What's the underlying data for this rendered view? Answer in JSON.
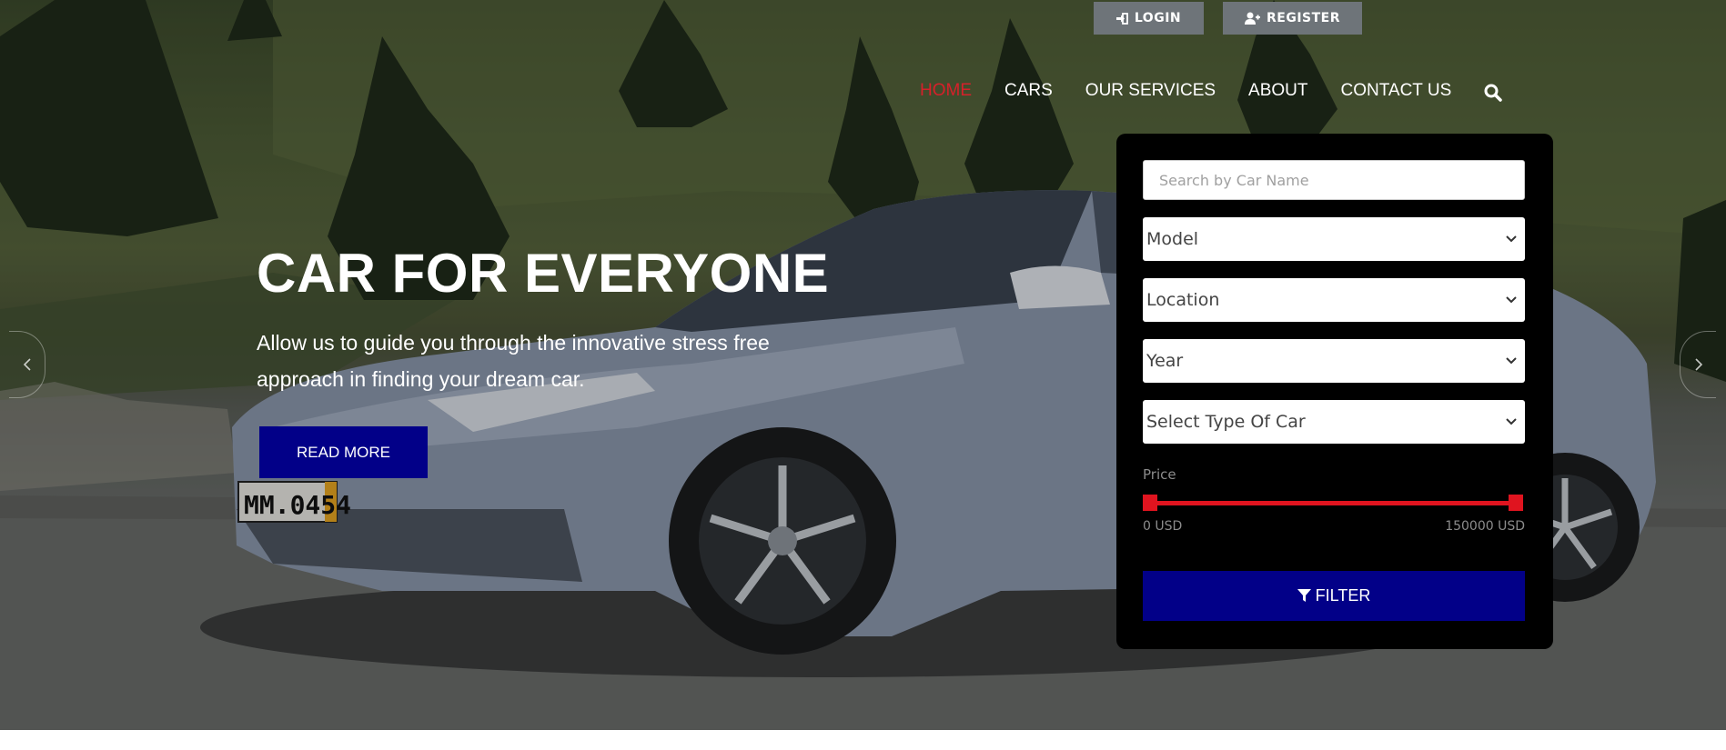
{
  "topbar": {
    "login_label": "LOGIN",
    "register_label": "REGISTER"
  },
  "nav": {
    "items": [
      {
        "label": "HOME",
        "active": true
      },
      {
        "label": "CARS"
      },
      {
        "label": "OUR SERVICES"
      },
      {
        "label": "ABOUT"
      },
      {
        "label": "CONTACT US"
      }
    ]
  },
  "hero": {
    "headline": "CAR FOR EVERYONE",
    "subtext": "Allow us to guide you through the innovative stress free approach in finding your dream car.",
    "button_label": "READ MORE",
    "plate_text": "MM.0454"
  },
  "filter": {
    "search_placeholder": "Search by Car Name",
    "selects": [
      "Model",
      "Location",
      "Year",
      "Select Type Of Car"
    ],
    "price_label": "Price",
    "price_min_label": "0 USD",
    "price_max_label": "150000 USD",
    "price_min_value": 0,
    "price_max_value": 150000,
    "button_label": "FILTER"
  },
  "colors": {
    "accent_red": "#e0141f",
    "brand_blue": "#020088",
    "panel_bg": "#000000",
    "nav_active": "#d6202a"
  }
}
